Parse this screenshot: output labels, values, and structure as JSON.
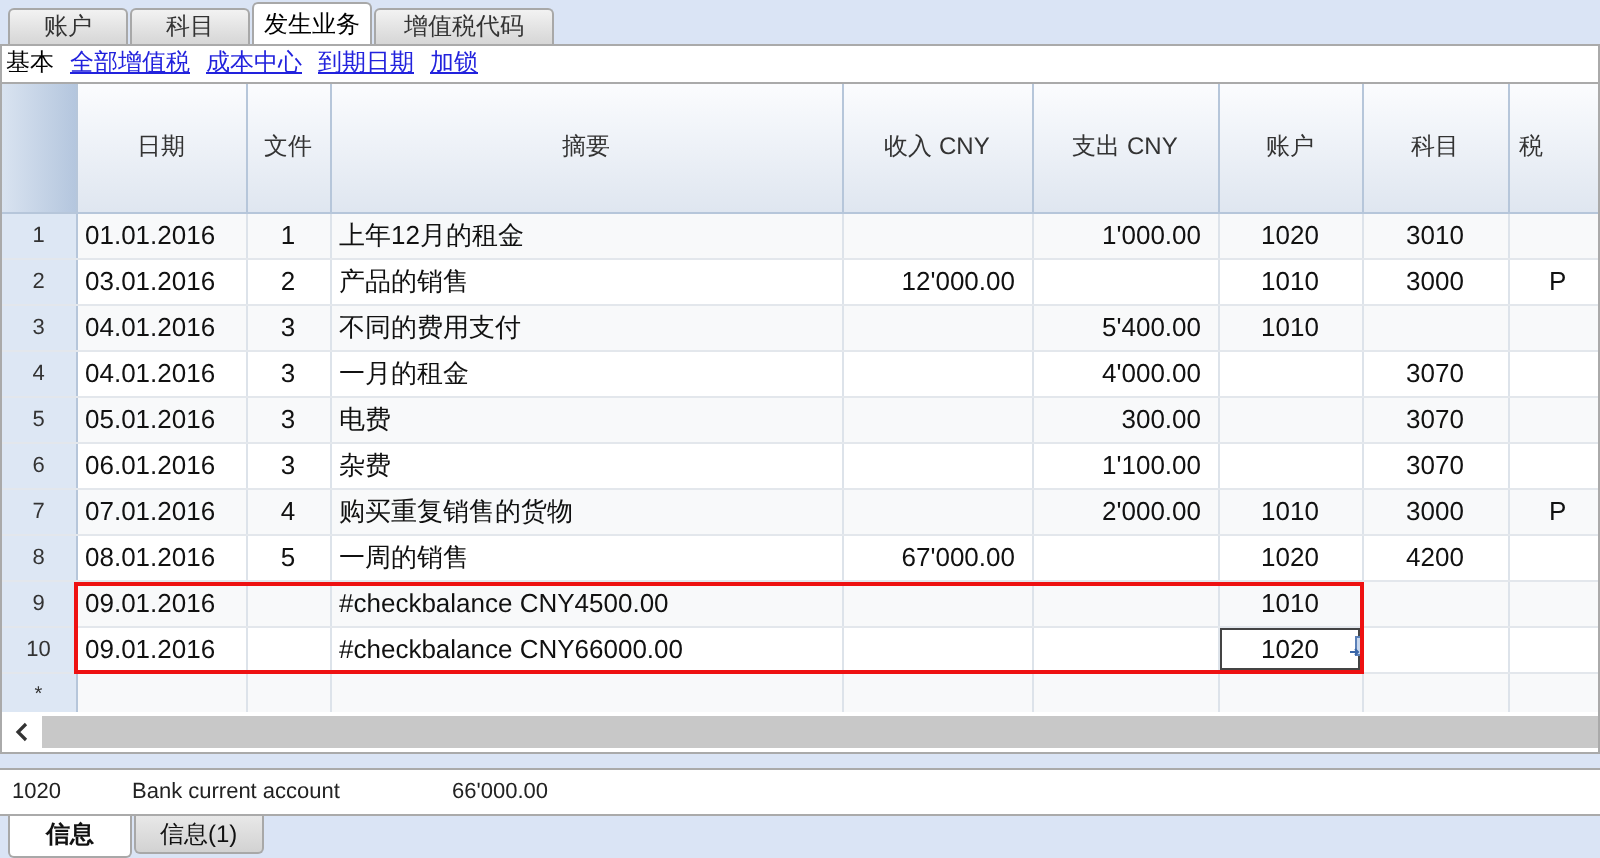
{
  "tabs": [
    {
      "label": "账户",
      "selected": false
    },
    {
      "label": "科目",
      "selected": false
    },
    {
      "label": "发生业务",
      "selected": true
    },
    {
      "label": "增值税代码",
      "selected": false
    }
  ],
  "views": [
    {
      "label": "基本",
      "selected": true
    },
    {
      "label": "全部增值税",
      "selected": false
    },
    {
      "label": "成本中心",
      "selected": false
    },
    {
      "label": "到期日期",
      "selected": false
    },
    {
      "label": "加锁",
      "selected": false
    }
  ],
  "table": {
    "columns": [
      "日期",
      "文件",
      "摘要",
      "收入 CNY",
      "支出 CNY",
      "账户",
      "科目",
      "税"
    ],
    "rows": [
      {
        "number": "1",
        "cells": [
          "01.01.2016",
          "1",
          "上年12月的租金",
          "",
          "1'000.00",
          "1020",
          "3010",
          ""
        ],
        "highlighted": false,
        "selected": false
      },
      {
        "number": "2",
        "cells": [
          "03.01.2016",
          "2",
          "产品的销售",
          "12'000.00",
          "",
          "1010",
          "3000",
          "P"
        ],
        "highlighted": false,
        "selected": false
      },
      {
        "number": "3",
        "cells": [
          "04.01.2016",
          "3",
          "不同的费用支付",
          "",
          "5'400.00",
          "1010",
          "",
          ""
        ],
        "highlighted": false,
        "selected": false
      },
      {
        "number": "4",
        "cells": [
          "04.01.2016",
          "3",
          "一月的租金",
          "",
          "4'000.00",
          "",
          "3070",
          ""
        ],
        "highlighted": false,
        "selected": false
      },
      {
        "number": "5",
        "cells": [
          "05.01.2016",
          "3",
          "电费",
          "",
          "300.00",
          "",
          "3070",
          ""
        ],
        "highlighted": false,
        "selected": false
      },
      {
        "number": "6",
        "cells": [
          "06.01.2016",
          "3",
          "杂费",
          "",
          "1'100.00",
          "",
          "3070",
          ""
        ],
        "highlighted": false,
        "selected": false
      },
      {
        "number": "7",
        "cells": [
          "07.01.2016",
          "4",
          "购买重复销售的货物",
          "",
          "2'000.00",
          "1010",
          "3000",
          "P"
        ],
        "highlighted": false,
        "selected": false
      },
      {
        "number": "8",
        "cells": [
          "08.01.2016",
          "5",
          "一周的销售",
          "67'000.00",
          "",
          "1020",
          "4200",
          ""
        ],
        "highlighted": false,
        "selected": false
      },
      {
        "number": "9",
        "cells": [
          "09.01.2016",
          "",
          "#checkbalance CNY4500.00",
          "",
          "",
          "1010",
          "",
          ""
        ],
        "highlighted": true,
        "selected": false
      },
      {
        "number": "10",
        "cells": [
          "09.01.2016",
          "",
          "#checkbalance CNY66000.00",
          "",
          "",
          "1020",
          "",
          ""
        ],
        "highlighted": true,
        "selected": true
      }
    ],
    "new_row_marker": "*"
  },
  "info_bar": {
    "account": "1020",
    "description": "Bank current account",
    "balance": "66'000.00"
  },
  "bottom_tabs": [
    {
      "label": "信息",
      "selected": true
    },
    {
      "label": "信息(1)",
      "selected": false
    }
  ]
}
